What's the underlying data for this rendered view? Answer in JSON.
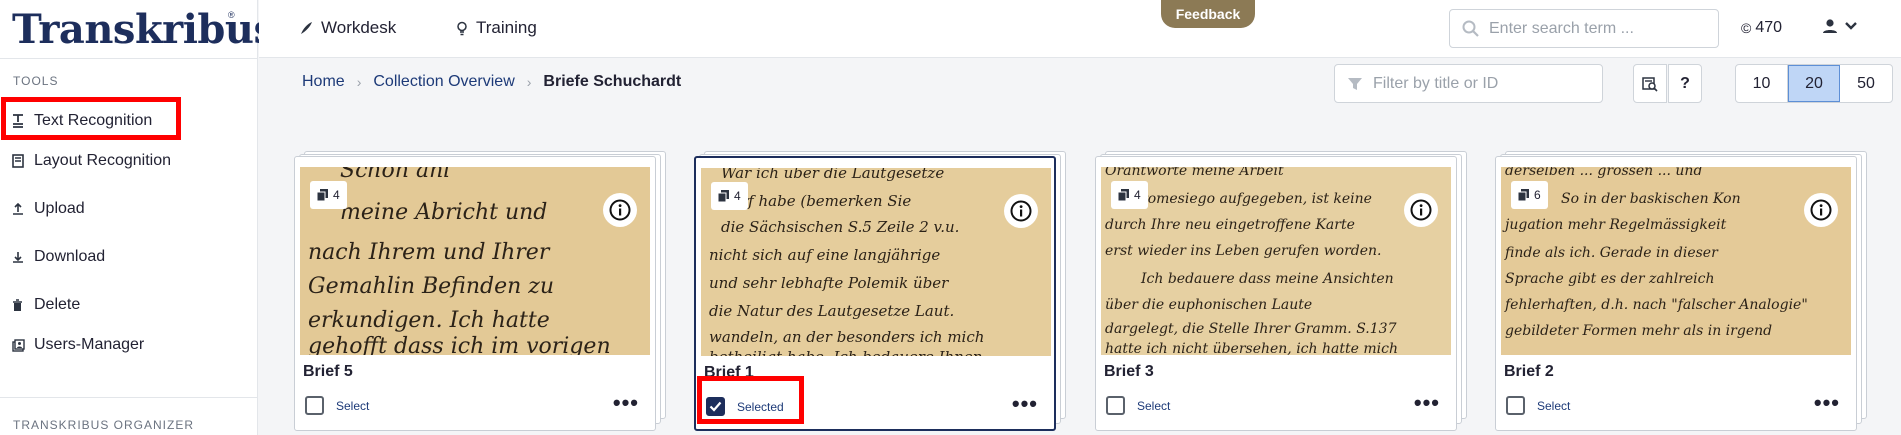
{
  "app": {
    "logo_text": "Transkribus",
    "logo_reg": "®"
  },
  "sidebar": {
    "tools_title": "TOOLS",
    "items": [
      {
        "label": "Text Recognition",
        "icon": "text-recognition-icon"
      },
      {
        "label": "Layout Recognition",
        "icon": "layout-icon"
      },
      {
        "label": "Upload",
        "icon": "upload-icon"
      },
      {
        "label": "Download",
        "icon": "download-icon"
      },
      {
        "label": "Delete",
        "icon": "trash-icon"
      },
      {
        "label": "Users-Manager",
        "icon": "users-manager-icon"
      }
    ],
    "organizer_title": "TRANSKRIBUS ORGANIZER"
  },
  "topbar": {
    "nav": [
      {
        "label": "Workdesk",
        "icon": "quill-icon"
      },
      {
        "label": "Training",
        "icon": "lightbulb-icon"
      }
    ],
    "feedback_label": "Feedback",
    "search_placeholder": "Enter search term ...",
    "credits_symbol": "©",
    "credits_value": "470"
  },
  "breadcrumb": {
    "home": "Home",
    "collection": "Collection Overview",
    "current": "Briefe Schuchardt",
    "separator": "›"
  },
  "filter": {
    "placeholder": "Filter by title or ID"
  },
  "toolbar": {
    "help_label": "?"
  },
  "page_size": {
    "options": [
      "10",
      "20",
      "50"
    ],
    "selected": "20"
  },
  "cards": [
    {
      "title": "Brief 5",
      "pages": "4",
      "select_label": "Select",
      "selected": false,
      "more": "•••"
    },
    {
      "title": "Brief 1",
      "pages": "4",
      "select_label": "Selected",
      "selected": true,
      "more": "•••"
    },
    {
      "title": "Brief 3",
      "pages": "4",
      "select_label": "Select",
      "selected": false,
      "more": "•••"
    },
    {
      "title": "Brief 2",
      "pages": "6",
      "select_label": "Select",
      "selected": false,
      "more": "•••"
    }
  ],
  "colors": {
    "brand": "#1d2e5c",
    "highlight": "#ff0000",
    "feedback_bg": "#8c7a55",
    "page_size_active": "#bfd6f6",
    "paper": "#e9d3a4"
  }
}
